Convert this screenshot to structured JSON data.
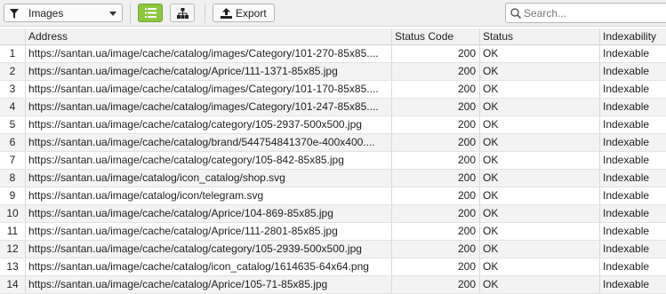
{
  "toolbar": {
    "filter_label": "Images",
    "export_label": "Export",
    "search_placeholder": "Search..."
  },
  "table": {
    "columns": [
      "",
      "Address",
      "Status Code",
      "Status",
      "Indexability"
    ],
    "rows": [
      {
        "num": "1",
        "address": "https://santan.ua/image/cache/catalog/images/Category/101-270-85x85....",
        "code": "200",
        "status": "OK",
        "indexability": "Indexable"
      },
      {
        "num": "2",
        "address": "https://santan.ua/image/cache/catalog/Aprice/111-1371-85x85.jpg",
        "code": "200",
        "status": "OK",
        "indexability": "Indexable"
      },
      {
        "num": "3",
        "address": "https://santan.ua/image/cache/catalog/images/Category/101-170-85x85....",
        "code": "200",
        "status": "OK",
        "indexability": "Indexable"
      },
      {
        "num": "4",
        "address": "https://santan.ua/image/cache/catalog/images/Category/101-247-85x85....",
        "code": "200",
        "status": "OK",
        "indexability": "Indexable"
      },
      {
        "num": "5",
        "address": "https://santan.ua/image/cache/catalog/category/105-2937-500x500.jpg",
        "code": "200",
        "status": "OK",
        "indexability": "Indexable"
      },
      {
        "num": "6",
        "address": "https://santan.ua/image/cache/catalog/brand/544754841370e-400x400....",
        "code": "200",
        "status": "OK",
        "indexability": "Indexable"
      },
      {
        "num": "7",
        "address": "https://santan.ua/image/cache/catalog/category/105-842-85x85.jpg",
        "code": "200",
        "status": "OK",
        "indexability": "Indexable"
      },
      {
        "num": "8",
        "address": "https://santan.ua/image/catalog/icon_catalog/shop.svg",
        "code": "200",
        "status": "OK",
        "indexability": "Indexable"
      },
      {
        "num": "9",
        "address": "https://santan.ua/image/catalog/icon/telegram.svg",
        "code": "200",
        "status": "OK",
        "indexability": "Indexable"
      },
      {
        "num": "10",
        "address": "https://santan.ua/image/cache/catalog/Aprice/104-869-85x85.jpg",
        "code": "200",
        "status": "OK",
        "indexability": "Indexable"
      },
      {
        "num": "11",
        "address": "https://santan.ua/image/cache/catalog/Aprice/111-2801-85x85.jpg",
        "code": "200",
        "status": "OK",
        "indexability": "Indexable"
      },
      {
        "num": "12",
        "address": "https://santan.ua/image/cache/catalog/category/105-2939-500x500.jpg",
        "code": "200",
        "status": "OK",
        "indexability": "Indexable"
      },
      {
        "num": "13",
        "address": "https://santan.ua/image/cache/catalog/icon_catalog/1614635-64x64.png",
        "code": "200",
        "status": "OK",
        "indexability": "Indexable"
      },
      {
        "num": "14",
        "address": "https://santan.ua/image/cache/catalog/Aprice/105-71-85x85.jpg",
        "code": "200",
        "status": "OK",
        "indexability": "Indexable"
      }
    ]
  },
  "icons": {
    "filter": "funnel-icon",
    "list_view": "list-view-icon",
    "tree_view": "tree-view-icon",
    "export": "export-upload-icon",
    "search": "search-icon"
  },
  "colors": {
    "active_view_button": "#8cc63f"
  }
}
